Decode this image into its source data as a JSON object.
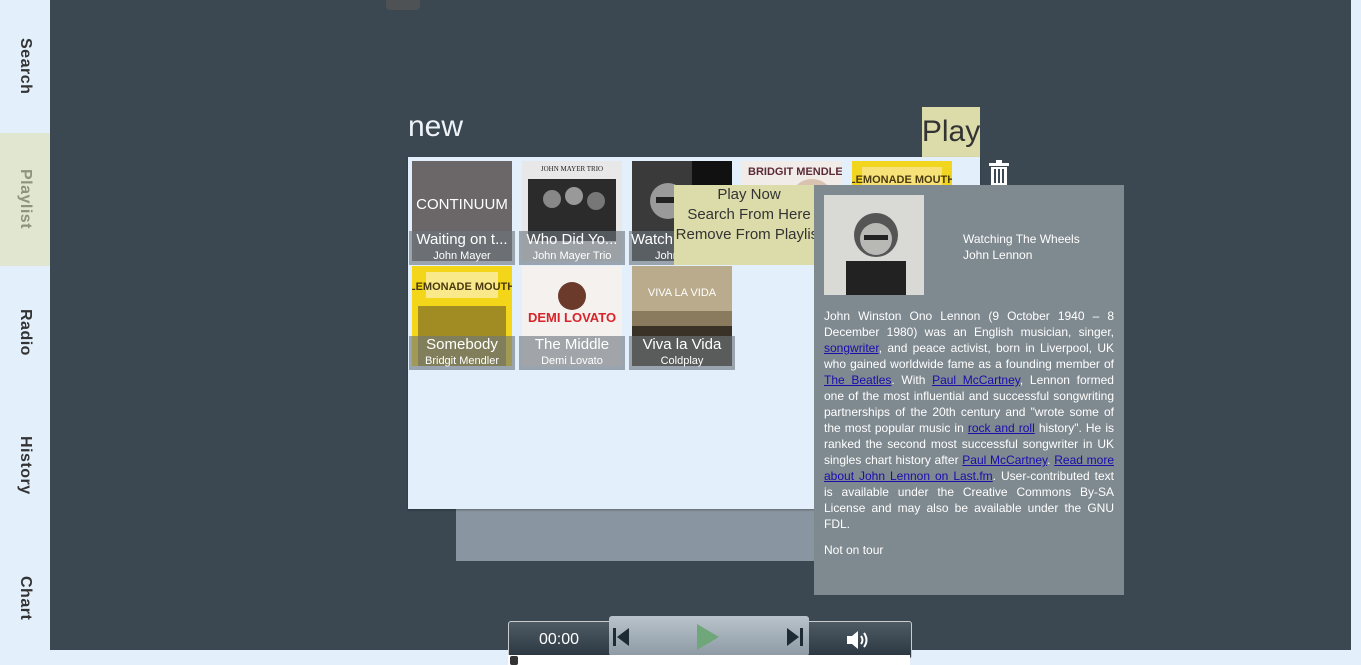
{
  "sidebar": {
    "tabs": [
      {
        "label": "Search"
      },
      {
        "label": "Playlist"
      },
      {
        "label": "Radio"
      },
      {
        "label": "History"
      },
      {
        "label": "Chart"
      }
    ],
    "active": "Playlist"
  },
  "playlist": {
    "title": "new",
    "play_label": "Play",
    "tracks": [
      {
        "name": "Waiting on t...",
        "artist": "John Mayer"
      },
      {
        "name": "Who Did Yo...",
        "artist": "John Mayer Trio"
      },
      {
        "name": "Watch",
        "artist": "John"
      },
      {
        "name": "",
        "artist": ""
      },
      {
        "name": "",
        "artist": ""
      },
      {
        "name": "Somebody",
        "artist": "Bridgit Mendler"
      },
      {
        "name": "The Middle",
        "artist": "Demi Lovato"
      },
      {
        "name": "Viva la Vida",
        "artist": "Coldplay"
      }
    ],
    "art_text": {
      "continuum": "CONTINUUM",
      "jmtrio": "JOHN MAYER TRIO",
      "bridgit": "BRIDGIT MENDLER",
      "lemonade": "LEMONADE MOUTH",
      "demi": "DEMI LOVATO",
      "viva": "VIVA LA VIDA"
    }
  },
  "context_menu": {
    "items": [
      "Play Now",
      "Search From Here",
      "Remove From Playlist"
    ]
  },
  "info": {
    "track": "Watching The Wheels",
    "artist": "John Lennon",
    "bio": {
      "p1": "John Winston Ono Lennon (9 October 1940 – 8 December 1980) was an English musician, singer, ",
      "link1": "songwriter",
      "p2": ", and peace activist, born in Liverpool, UK who gained worldwide fame as a founding member of ",
      "link2": "The Beatles",
      "p3": ". With ",
      "link3": "Paul McCartney",
      "p4": ", Lennon formed one of the most influential and successful songwriting partnerships of the 20th century and \"wrote some of the most popular music in ",
      "link4": "rock and roll",
      "p5": " history\". He is ranked the second most successful songwriter in UK singles chart history after ",
      "link5": "Paul McCartney",
      "p6": ". ",
      "link6": "Read more about John Lennon on Last.fm",
      "p7": ". User-contributed text is available under the Creative Commons By-SA License and may also be available under the GNU FDL."
    },
    "tour": "Not on tour"
  },
  "player": {
    "time": "00:00",
    "progress": 0
  },
  "colors": {
    "background": "#3b4852",
    "sidebar": "#e3f0fb",
    "accent": "#dcdcaa",
    "info_panel": "#7f8990",
    "play_icon": "#6fa77a"
  }
}
